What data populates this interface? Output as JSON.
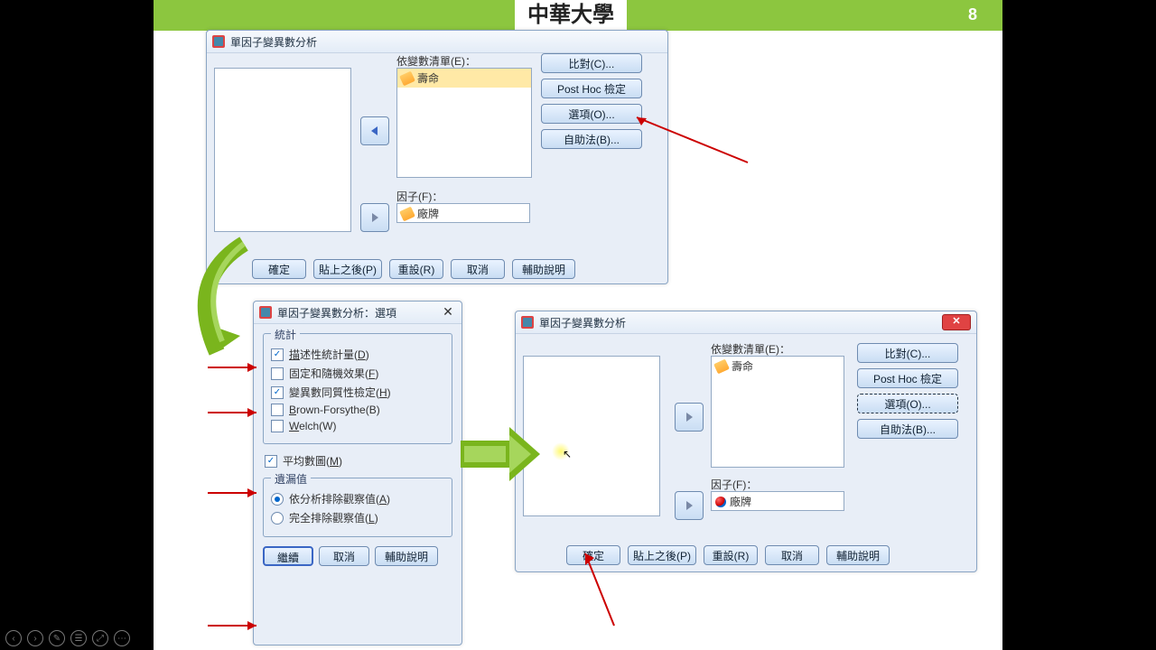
{
  "slide": {
    "number": "8",
    "university": "中華大學"
  },
  "dialog1": {
    "title": "單因子變異數分析",
    "dep_label": "依變數清單(E)：",
    "dep_item": "壽命",
    "factor_label": "因子(F)：",
    "factor_item": "廠牌",
    "side": {
      "contrast": "比對(C)...",
      "posthoc": "Post Hoc 檢定(H)...",
      "options": "選項(O)...",
      "bootstrap": "自助法(B)..."
    },
    "bottom": {
      "ok": "確定",
      "paste": "貼上之後(P)",
      "reset": "重設(R)",
      "cancel": "取消",
      "help": "輔助說明"
    }
  },
  "dialog_options": {
    "title": "單因子變異數分析：選項",
    "group_stats": "統計",
    "opt_descriptive": "描述性統計量(D)",
    "opt_fixed": "固定和隨機效果(F)",
    "opt_homog": "變異數同質性檢定(H)",
    "opt_bf": "Brown-Forsythe(B)",
    "opt_welch": "Welch(W)",
    "opt_means": "平均數圖(M)",
    "group_missing": "遺漏值",
    "opt_analysis": "依分析排除觀察值(A)",
    "opt_listwise": "完全排除觀察值(L)",
    "btn_continue": "繼續",
    "btn_cancel": "取消",
    "btn_help": "輔助說明"
  },
  "dialog2": {
    "title": "單因子變異數分析",
    "dep_label": "依變數清單(E)：",
    "dep_item": "壽命",
    "factor_label": "因子(F)：",
    "factor_item": "廠牌",
    "side": {
      "contrast": "比對(C)...",
      "posthoc": "Post Hoc 檢定(H)...",
      "options": "選項(O)...",
      "bootstrap": "自助法(B)..."
    },
    "bottom": {
      "ok": "確定",
      "paste": "貼上之後(P)",
      "reset": "重設(R)",
      "cancel": "取消",
      "help": "輔助說明"
    }
  }
}
